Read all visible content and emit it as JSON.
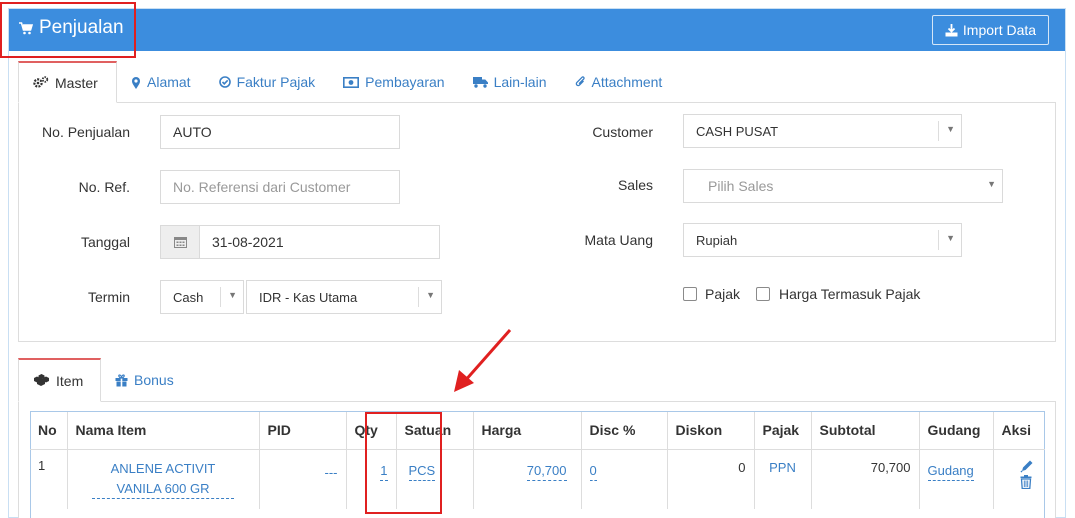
{
  "header": {
    "title": "Penjualan",
    "import_label": "Import Data"
  },
  "colors": {
    "header_bg": "#3c8dde",
    "link": "#3a7fc5",
    "highlight": "#e02020",
    "active_tab_accent": "#e06060"
  },
  "main_tabs": [
    {
      "label": "Master",
      "icon": "cogs-icon",
      "active": true
    },
    {
      "label": "Alamat",
      "icon": "map-marker-icon"
    },
    {
      "label": "Faktur Pajak",
      "icon": "check-circle-icon"
    },
    {
      "label": "Pembayaran",
      "icon": "money-icon"
    },
    {
      "label": "Lain-lain",
      "icon": "truck-icon"
    },
    {
      "label": "Attachment",
      "icon": "paperclip-icon"
    }
  ],
  "form": {
    "no_penjualan": {
      "label": "No. Penjualan",
      "value": "AUTO"
    },
    "no_ref": {
      "label": "No. Ref.",
      "placeholder": "No. Referensi dari Customer"
    },
    "tanggal": {
      "label": "Tanggal",
      "value": "31-08-2021"
    },
    "termin": {
      "label": "Termin",
      "value": "Cash",
      "account": "IDR - Kas Utama"
    },
    "customer": {
      "label": "Customer",
      "value": "CASH PUSAT"
    },
    "sales": {
      "label": "Sales",
      "placeholder": "Pilih Sales"
    },
    "mata_uang": {
      "label": "Mata Uang",
      "value": "Rupiah"
    },
    "pajak_label": "Pajak",
    "harga_termasuk_pajak_label": "Harga Termasuk Pajak"
  },
  "item_tabs": [
    {
      "label": "Item",
      "icon": "cubes-icon",
      "active": true
    },
    {
      "label": "Bonus",
      "icon": "gift-icon"
    }
  ],
  "table": {
    "headers": [
      "No",
      "Nama Item",
      "PID",
      "Qty",
      "Satuan",
      "Harga",
      "Disc %",
      "Diskon",
      "Pajak",
      "Subtotal",
      "Gudang",
      "Aksi"
    ],
    "rows": [
      {
        "no": "1",
        "nama_item_line1": "ANLENE ACTIVIT",
        "nama_item_line2": "VANILA 600 GR",
        "pid": "---",
        "qty": "1",
        "satuan": "PCS",
        "harga": "70,700",
        "disc": "0",
        "diskon": "0",
        "pajak": "PPN",
        "subtotal": "70,700",
        "gudang": "Gudang"
      }
    ]
  }
}
